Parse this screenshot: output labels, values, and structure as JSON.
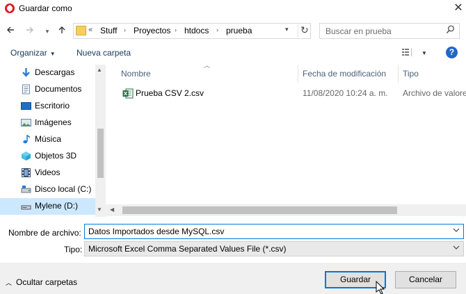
{
  "window": {
    "title": "Guardar como",
    "close_label": "✕"
  },
  "nav": {
    "back_icon": "arrow-left-icon",
    "forward_icon": "arrow-right-icon",
    "recent_icon": "chevron-down-icon",
    "up_icon": "arrow-up-icon"
  },
  "address": {
    "overflow_label": "«",
    "crumbs": [
      "Stuff",
      "Proyectos",
      "htdocs",
      "prueba"
    ]
  },
  "search": {
    "placeholder": "Buscar en prueba"
  },
  "toolbar": {
    "organize_label": "Organizar",
    "new_folder_label": "Nueva carpeta",
    "help_label": "?"
  },
  "sidebar": {
    "items": [
      {
        "label": "Descargas",
        "icon": "download-arrow-icon"
      },
      {
        "label": "Documentos",
        "icon": "documents-icon"
      },
      {
        "label": "Escritorio",
        "icon": "desktop-icon"
      },
      {
        "label": "Imágenes",
        "icon": "pictures-icon"
      },
      {
        "label": "Música",
        "icon": "music-note-icon"
      },
      {
        "label": "Objetos 3D",
        "icon": "cube-3d-icon"
      },
      {
        "label": "Videos",
        "icon": "film-icon"
      },
      {
        "label": "Disco local (C:)",
        "icon": "hard-drive-icon"
      },
      {
        "label": "Mylene (D:)",
        "icon": "drive-icon",
        "selected": true
      }
    ]
  },
  "files": {
    "columns": [
      "Nombre",
      "Fecha de modificación",
      "Tipo"
    ],
    "rows": [
      {
        "name": "Prueba CSV 2.csv",
        "modified": "11/08/2020 10:24 a. m.",
        "type": "Archivo de valores"
      }
    ]
  },
  "form": {
    "filename_label": "Nombre de archivo:",
    "filename_value": "Datos Importados desde MySQL.csv",
    "type_label": "Tipo:",
    "type_value": "Microsoft Excel Comma Separated Values File (*.csv)"
  },
  "footer": {
    "hide_folders_label": "Ocultar carpetas",
    "save_label": "Guardar",
    "cancel_label": "Cancelar"
  },
  "colors": {
    "accent": "#0078d7",
    "selection": "#cce8ff",
    "help": "#2266c8",
    "brand": "#e11b22"
  }
}
